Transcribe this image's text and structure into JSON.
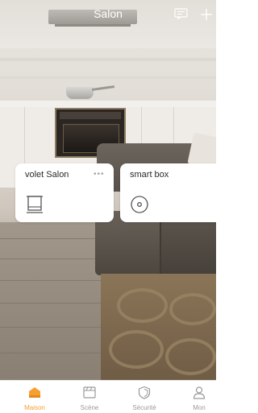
{
  "header": {
    "title": "Salon",
    "message_icon": "message-icon",
    "add_icon": "plus-icon"
  },
  "devices": [
    {
      "name": "volet Salon",
      "icon": "blind-icon",
      "has_more_menu": true
    },
    {
      "name": "smart box",
      "icon": "speaker-disc-icon",
      "has_more_menu": false
    }
  ],
  "more_glyph": "•••",
  "tabs": [
    {
      "label": "Maison",
      "icon": "house-icon",
      "active": true
    },
    {
      "label": "Scène",
      "icon": "scene-icon",
      "active": false
    },
    {
      "label": "Sécurité",
      "icon": "shield-icon",
      "active": false
    },
    {
      "label": "Mon",
      "icon": "profile-icon",
      "active": false
    }
  ],
  "colors": {
    "accent": "#f7a031",
    "tab_inactive": "#9a9a9a",
    "card_bg": "#ffffff"
  }
}
